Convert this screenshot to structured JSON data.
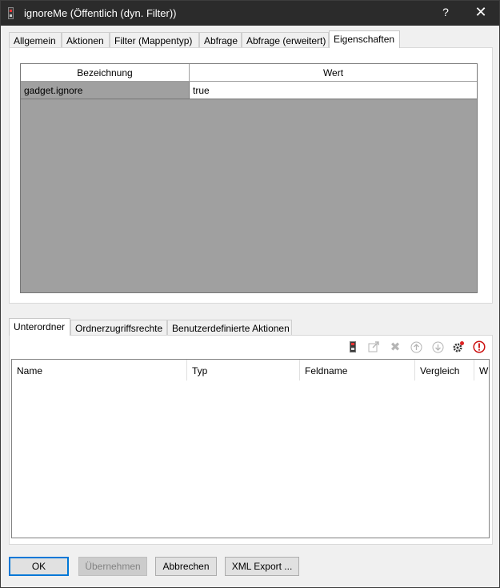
{
  "window": {
    "title": "ignoreMe (Öffentlich (dyn. Filter))",
    "help_label": "?",
    "close_label": "✕"
  },
  "tabs": [
    {
      "label": "Allgemein"
    },
    {
      "label": "Aktionen"
    },
    {
      "label": "Filter (Mappentyp)"
    },
    {
      "label": "Abfrage"
    },
    {
      "label": "Abfrage (erweitert)"
    },
    {
      "label": "Eigenschaften",
      "active": true
    }
  ],
  "properties": {
    "columns": [
      "Bezeichnung",
      "Wert"
    ],
    "rows": [
      {
        "name": "gadget.ignore",
        "value": "true"
      }
    ]
  },
  "bottom_tabs": [
    {
      "label": "Unterordner",
      "active": true
    },
    {
      "label": "Ordnerzugriffsrechte"
    },
    {
      "label": "Benutzerdefinierte Aktionen"
    }
  ],
  "toolbar": {
    "icons": [
      "filter-icon",
      "edit-icon",
      "delete-icon",
      "move-up-icon",
      "move-down-icon",
      "settings-icon",
      "warning-icon"
    ]
  },
  "subfolder_grid": {
    "columns": [
      "Name",
      "Typ",
      "Feldname",
      "Vergleich",
      "W"
    ]
  },
  "buttons": {
    "ok": "OK",
    "apply": "Übernehmen",
    "cancel": "Abbrechen",
    "xml_export": "XML Export ..."
  },
  "colors": {
    "title_bg": "#2b2b2b",
    "accent": "#0078d7",
    "grid_empty": "#a0a0a0",
    "warning": "#cc1111"
  }
}
